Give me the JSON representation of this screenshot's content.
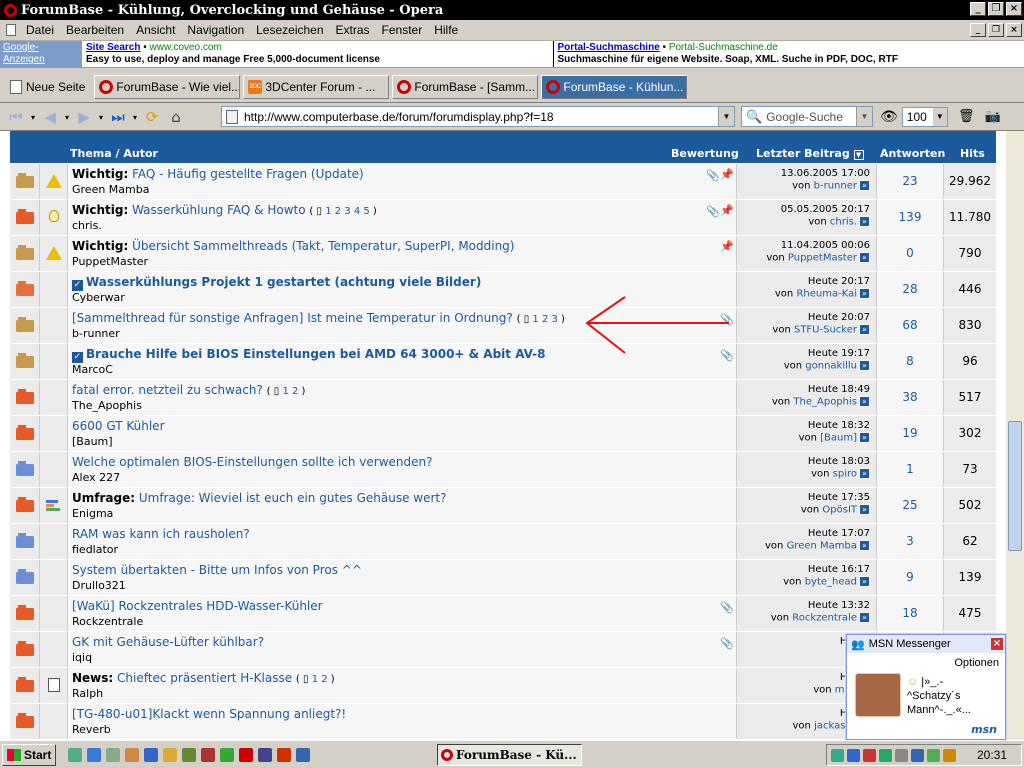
{
  "window": {
    "title": "ForumBase - Kühlung, Overclocking und Gehäuse - Opera"
  },
  "menu": [
    "Datei",
    "Bearbeiten",
    "Ansicht",
    "Navigation",
    "Lesezeichen",
    "Extras",
    "Fenster",
    "Hilfe"
  ],
  "ads": {
    "label": "Google-Anzeigen",
    "ad1": {
      "title": "Site Search",
      "url": "www.coveo.com",
      "desc": "Easy to use, deploy and manage Free 5,000-document license"
    },
    "ad2": {
      "title": "Portal-Suchmaschine",
      "url": "Portal-Suchmaschine.de",
      "desc": "Suchmaschine für eigene Website. Soap, XML. Suche in PDF, DOC, RTF"
    }
  },
  "tabs": {
    "newpage": "Neue Seite",
    "items": [
      "ForumBase - Wie viel...",
      "3DCenter Forum - ...",
      "ForumBase - [Samm...",
      "ForumBase - Kühlun..."
    ]
  },
  "nav": {
    "address": "http://www.computerbase.de/forum/forumdisplay.php?f=18",
    "search_placeholder": "Google-Suche",
    "zoom": "100"
  },
  "table": {
    "h_thema": "Thema / Autor",
    "h_bewertung": "Bewertung",
    "h_letzter": "Letzter Beitrag",
    "h_antworten": "Antworten",
    "h_hits": "Hits"
  },
  "rows": [
    {
      "prefix": "Wichtig:",
      "title": "FAQ - Häufig gestellte Fragen (Update)",
      "pages": "",
      "author": "Green Mamba",
      "date": "13.06.2005",
      "time": "17:00",
      "user": "b-runner",
      "replies": "23",
      "hits": "29.962"
    },
    {
      "prefix": "Wichtig:",
      "title": "Wasserkühlung FAQ & Howto",
      "pages": "1 2 3 4 5",
      "author": "chris.",
      "date": "05.05.2005",
      "time": "20:17",
      "user": "chris.",
      "replies": "139",
      "hits": "11.780"
    },
    {
      "prefix": "Wichtig:",
      "title": "Übersicht Sammelthreads (Takt, Temperatur, SuperPI, Modding)",
      "pages": "",
      "author": "PuppetMaster",
      "date": "11.04.2005",
      "time": "00:06",
      "user": "PuppetMaster",
      "replies": "0",
      "hits": "790"
    },
    {
      "prefix": "",
      "title": "Wasserkühlungs Projekt 1 gestartet (achtung viele Bilder)",
      "pages": "",
      "author": "Cyberwar",
      "date": "Heute",
      "time": "20:17",
      "user": "Rheuma-Kai",
      "replies": "28",
      "hits": "446"
    },
    {
      "prefix": "",
      "title": "[Sammelthread für sonstige Anfragen] Ist meine Temperatur in Ordnung?",
      "pages": "1 2 3",
      "author": "b-runner",
      "date": "Heute",
      "time": "20:07",
      "user": "STFU-Sucker",
      "replies": "68",
      "hits": "830"
    },
    {
      "prefix": "",
      "title": "Brauche Hilfe bei BIOS Einstellungen bei AMD 64 3000+ & Abit AV-8",
      "pages": "",
      "author": "MarcoC",
      "date": "Heute",
      "time": "19:17",
      "user": "gonnakillu",
      "replies": "8",
      "hits": "96"
    },
    {
      "prefix": "",
      "title": "fatal error. netzteil zu schwach?",
      "pages": "1 2",
      "author": "The_Apophis",
      "date": "Heute",
      "time": "18:49",
      "user": "The_Apophis",
      "replies": "38",
      "hits": "517"
    },
    {
      "prefix": "",
      "title": "6600 GT Kühler",
      "pages": "",
      "author": "[Baum]",
      "date": "Heute",
      "time": "18:32",
      "user": "[Baum]",
      "replies": "19",
      "hits": "302"
    },
    {
      "prefix": "",
      "title": "Welche optimalen BIOS-Einstellungen sollte ich verwenden?",
      "pages": "",
      "author": "Alex 227",
      "date": "Heute",
      "time": "18:03",
      "user": "spiro",
      "replies": "1",
      "hits": "73"
    },
    {
      "prefix": "Umfrage:",
      "title": "Umfrage: Wieviel ist euch ein gutes Gehäuse wert?",
      "pages": "",
      "author": "Enigma",
      "date": "Heute",
      "time": "17:35",
      "user": "OpösIT",
      "replies": "25",
      "hits": "502"
    },
    {
      "prefix": "",
      "title": "RAM was kann ich rausholen?",
      "pages": "",
      "author": "fiedlator",
      "date": "Heute",
      "time": "17:07",
      "user": "Green Mamba",
      "replies": "3",
      "hits": "62"
    },
    {
      "prefix": "",
      "title": "System übertakten - Bitte um Infos von Pros ^^",
      "pages": "",
      "author": "Drullo321",
      "date": "Heute",
      "time": "16:17",
      "user": "byte_head",
      "replies": "9",
      "hits": "139"
    },
    {
      "prefix": "",
      "title": "[WaKü] Rockzentrales HDD-Wasser-Kühler",
      "pages": "",
      "author": "Rockzentrale",
      "date": "Heute",
      "time": "13:32",
      "user": "Rockzentrale",
      "replies": "18",
      "hits": "475"
    },
    {
      "prefix": "",
      "title": "GK mit Gehäuse-Lüfter kühlbar?",
      "pages": "",
      "author": "iqiq",
      "date": "Heute",
      "time": "",
      "user": "",
      "replies": "",
      "hits": ""
    },
    {
      "prefix": "News:",
      "title": "Chieftec präsentiert H-Klasse",
      "pages": "1 2",
      "author": "Ralph",
      "date": "Heute",
      "time": "",
      "user": "moq",
      "replies": "",
      "hits": ""
    },
    {
      "prefix": "",
      "title": "[TG-480-u01]Klackt wenn Spannung anliegt?!",
      "pages": "",
      "author": "Reverb",
      "date": "Heute",
      "time": "",
      "user": "jackass9",
      "replies": "",
      "hits": ""
    }
  ],
  "von": "von",
  "msn": {
    "title": "MSN Messenger",
    "options": "Optionen",
    "line1": "|»_.-",
    "line2": "^Schatzy´s",
    "line3": "Mann^-._.«...",
    "brand": "msn"
  },
  "taskbar": {
    "start": "Start",
    "task": "ForumBase - Kü...",
    "clock": "20:31"
  }
}
